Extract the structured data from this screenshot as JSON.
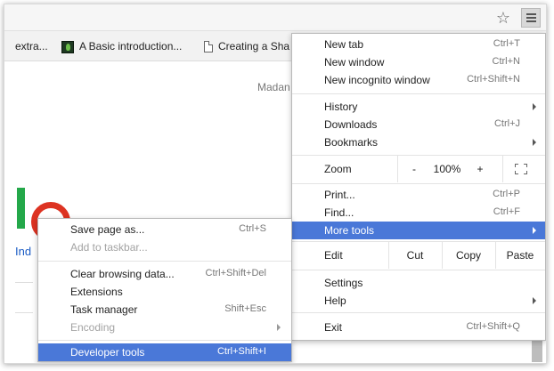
{
  "bookmarks_bar": {
    "items": [
      {
        "label": "extra..."
      },
      {
        "label": "A Basic introduction..."
      },
      {
        "label": "Creating a Sha"
      }
    ]
  },
  "page": {
    "madam_text": "Madan",
    "link_text": "Ind"
  },
  "chrome_menu": {
    "new_tab": {
      "label": "New tab",
      "shortcut": "Ctrl+T"
    },
    "new_window": {
      "label": "New window",
      "shortcut": "Ctrl+N"
    },
    "new_incognito": {
      "label": "New incognito window",
      "shortcut": "Ctrl+Shift+N"
    },
    "history": {
      "label": "History"
    },
    "downloads": {
      "label": "Downloads",
      "shortcut": "Ctrl+J"
    },
    "bookmarks": {
      "label": "Bookmarks"
    },
    "zoom": {
      "label": "Zoom",
      "minus": "-",
      "value": "100%",
      "plus": "+"
    },
    "print": {
      "label": "Print...",
      "shortcut": "Ctrl+P"
    },
    "find": {
      "label": "Find...",
      "shortcut": "Ctrl+F"
    },
    "more_tools": {
      "label": "More tools"
    },
    "edit": {
      "label": "Edit",
      "cut": "Cut",
      "copy": "Copy",
      "paste": "Paste"
    },
    "settings": {
      "label": "Settings"
    },
    "help": {
      "label": "Help"
    },
    "exit": {
      "label": "Exit",
      "shortcut": "Ctrl+Shift+Q"
    }
  },
  "more_tools_submenu": {
    "save_page": {
      "label": "Save page as...",
      "shortcut": "Ctrl+S"
    },
    "add_taskbar": {
      "label": "Add to taskbar..."
    },
    "clear_browsing": {
      "label": "Clear browsing data...",
      "shortcut": "Ctrl+Shift+Del"
    },
    "extensions": {
      "label": "Extensions"
    },
    "task_manager": {
      "label": "Task manager",
      "shortcut": "Shift+Esc"
    },
    "encoding": {
      "label": "Encoding"
    },
    "developer_tools": {
      "label": "Developer tools",
      "shortcut": "Ctrl+Shift+I"
    }
  },
  "colors": {
    "highlight": "#4a78d8",
    "link": "#1a5bc4",
    "logo_green": "#24a84a",
    "logo_red": "#dd3322"
  }
}
